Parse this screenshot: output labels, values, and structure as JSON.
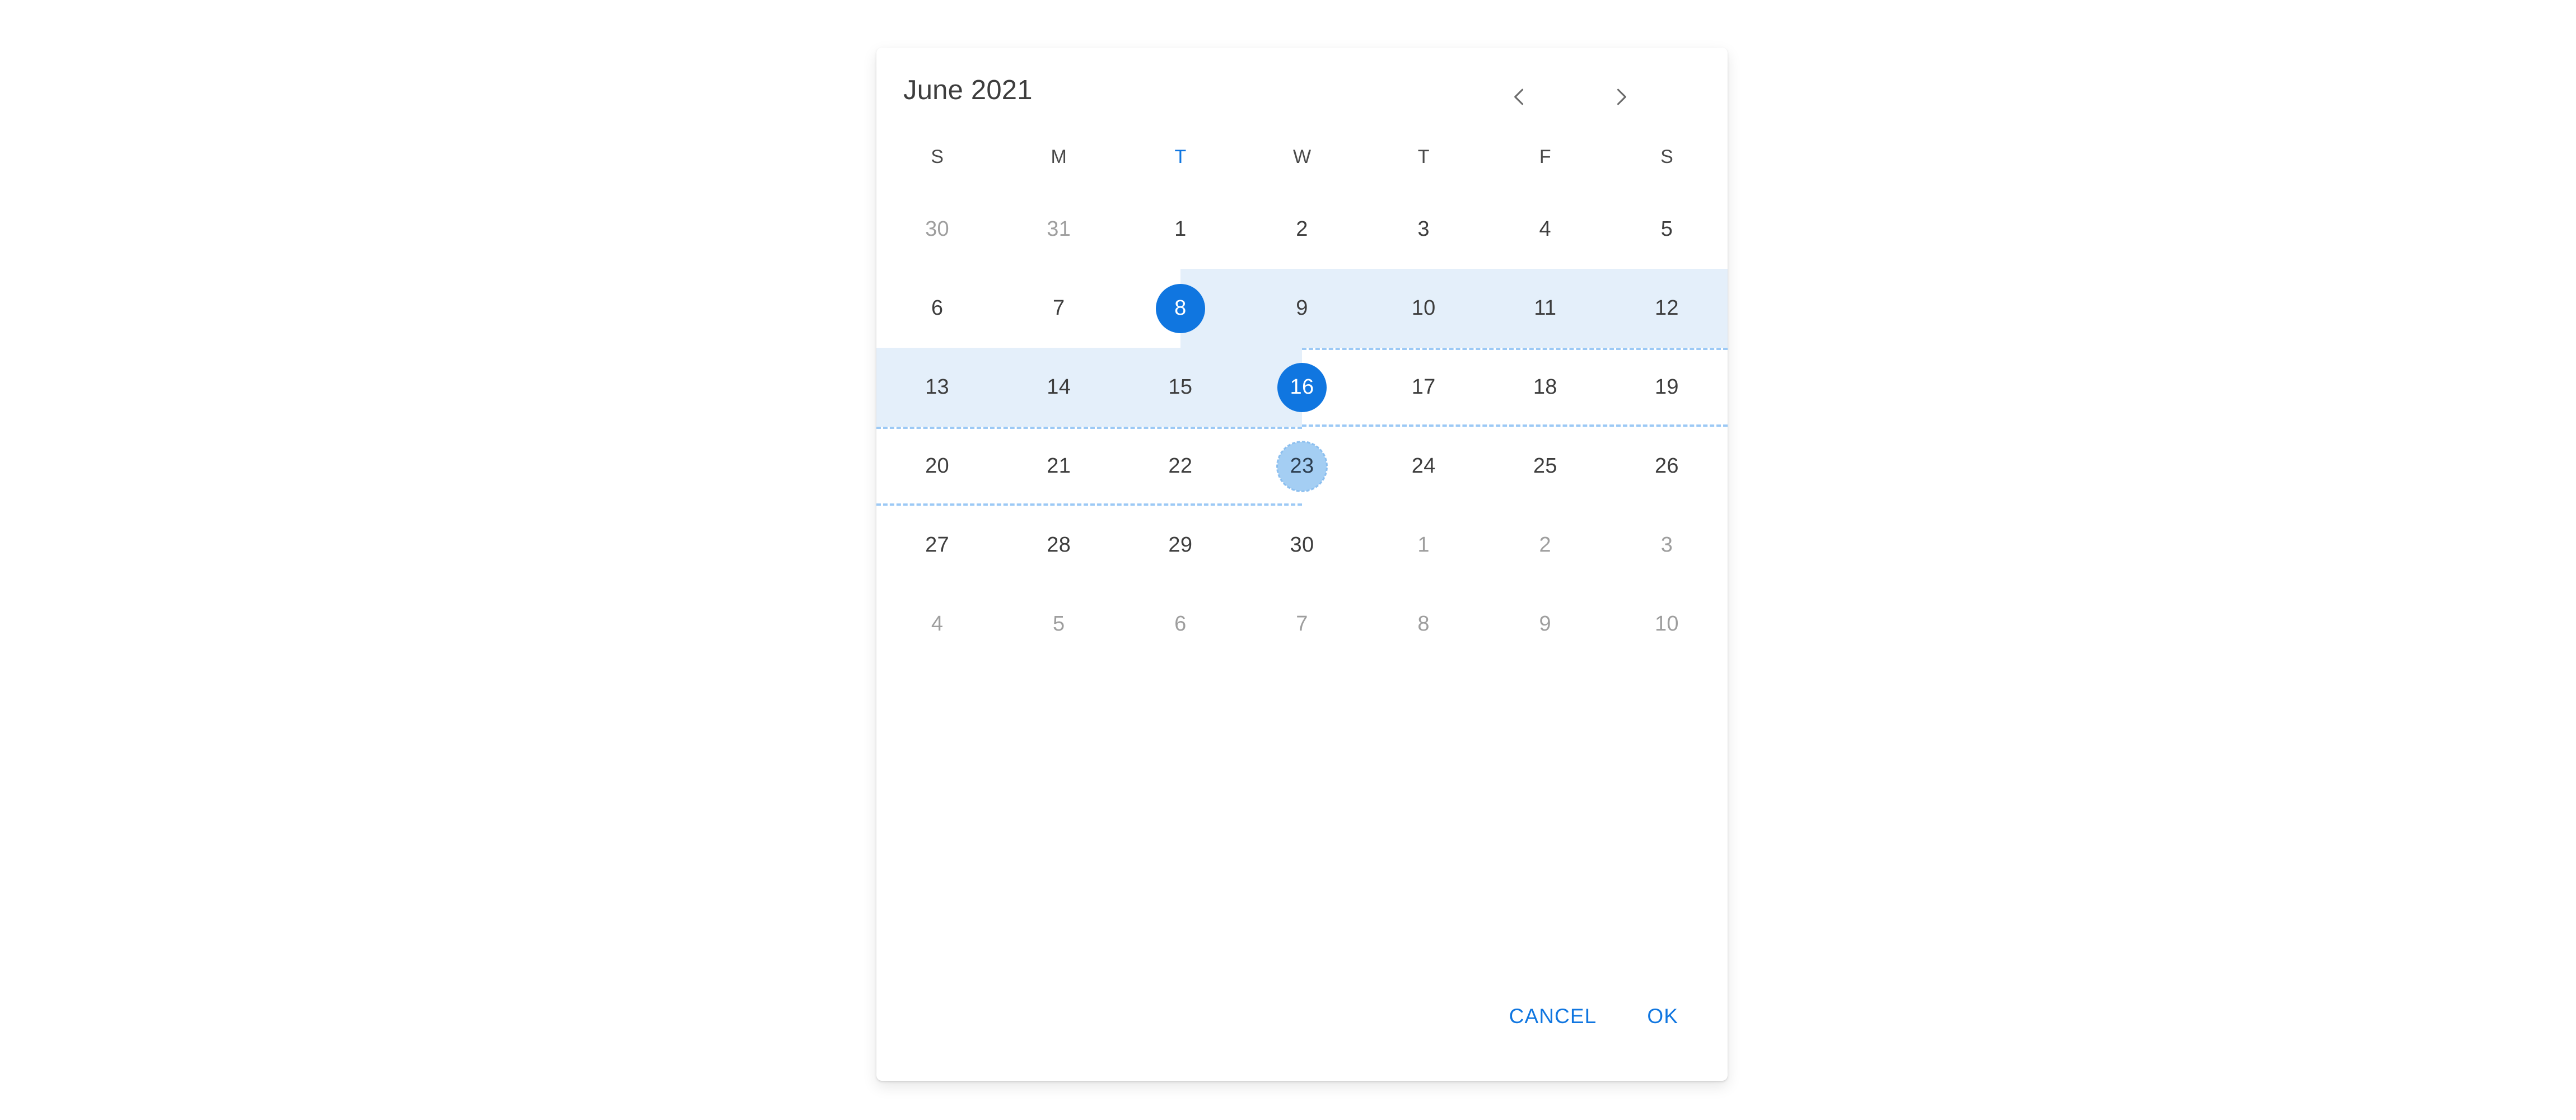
{
  "card": {
    "header": {
      "title": "June 2021",
      "prev_icon": "chevron-left-icon",
      "next_icon": "chevron-right-icon"
    },
    "weekdays": [
      {
        "label": "S",
        "accent": false
      },
      {
        "label": "M",
        "accent": false
      },
      {
        "label": "T",
        "accent": true
      },
      {
        "label": "W",
        "accent": false
      },
      {
        "label": "T",
        "accent": false
      },
      {
        "label": "F",
        "accent": false
      },
      {
        "label": "S",
        "accent": false
      }
    ],
    "weeks": [
      [
        {
          "day": "30",
          "state": "muted"
        },
        {
          "day": "31",
          "state": "muted"
        },
        {
          "day": "1",
          "state": "normal"
        },
        {
          "day": "2",
          "state": "normal"
        },
        {
          "day": "3",
          "state": "normal"
        },
        {
          "day": "4",
          "state": "normal"
        },
        {
          "day": "5",
          "state": "normal"
        }
      ],
      [
        {
          "day": "6",
          "state": "normal"
        },
        {
          "day": "7",
          "state": "normal"
        },
        {
          "day": "8",
          "state": "selected"
        },
        {
          "day": "9",
          "state": "normal"
        },
        {
          "day": "10",
          "state": "normal"
        },
        {
          "day": "11",
          "state": "normal"
        },
        {
          "day": "12",
          "state": "normal"
        }
      ],
      [
        {
          "day": "13",
          "state": "normal"
        },
        {
          "day": "14",
          "state": "normal"
        },
        {
          "day": "15",
          "state": "normal"
        },
        {
          "day": "16",
          "state": "selected"
        },
        {
          "day": "17",
          "state": "normal"
        },
        {
          "day": "18",
          "state": "normal"
        },
        {
          "day": "19",
          "state": "normal"
        }
      ],
      [
        {
          "day": "20",
          "state": "normal"
        },
        {
          "day": "21",
          "state": "normal"
        },
        {
          "day": "22",
          "state": "normal"
        },
        {
          "day": "23",
          "state": "preview"
        },
        {
          "day": "24",
          "state": "normal"
        },
        {
          "day": "25",
          "state": "normal"
        },
        {
          "day": "26",
          "state": "normal"
        }
      ],
      [
        {
          "day": "27",
          "state": "normal"
        },
        {
          "day": "28",
          "state": "normal"
        },
        {
          "day": "29",
          "state": "normal"
        },
        {
          "day": "30",
          "state": "normal"
        },
        {
          "day": "1",
          "state": "muted"
        },
        {
          "day": "2",
          "state": "muted"
        },
        {
          "day": "3",
          "state": "muted"
        }
      ],
      [
        {
          "day": "4",
          "state": "muted"
        },
        {
          "day": "5",
          "state": "muted"
        },
        {
          "day": "6",
          "state": "muted"
        },
        {
          "day": "7",
          "state": "muted"
        },
        {
          "day": "8",
          "state": "muted"
        },
        {
          "day": "9",
          "state": "muted"
        },
        {
          "day": "10",
          "state": "muted"
        }
      ]
    ],
    "selection": {
      "start_day": "8",
      "end_day": "16",
      "hover_preview_day": "23"
    },
    "footer": {
      "cancel_label": "CANCEL",
      "ok_label": "OK"
    }
  },
  "colors": {
    "accent": "#1076E0",
    "range_band": "#E4EFFA",
    "preview_circle": "#A4CEF3",
    "preview_dash": "#9CC9F5",
    "muted_text": "#9E9E9E",
    "title_text": "#3D3D3D",
    "card_background": "#FFFFFF",
    "page_background": "#FFFFFF"
  }
}
